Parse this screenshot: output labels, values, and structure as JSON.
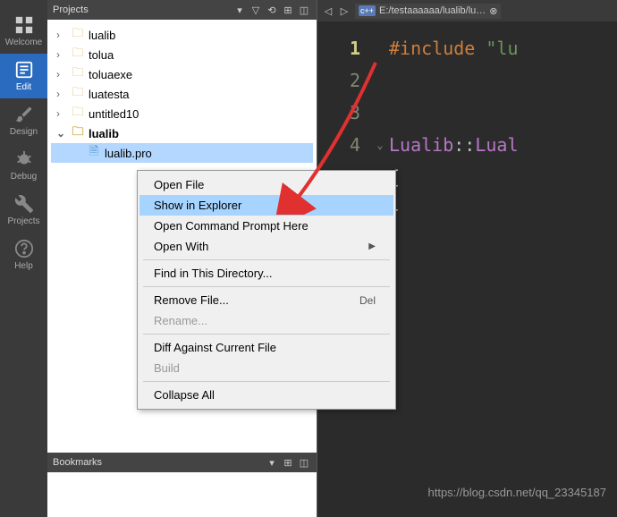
{
  "sidebar": {
    "items": [
      {
        "label": "Welcome",
        "active": false
      },
      {
        "label": "Edit",
        "active": true
      },
      {
        "label": "Design",
        "active": false
      },
      {
        "label": "Debug",
        "active": false
      },
      {
        "label": "Projects",
        "active": false
      },
      {
        "label": "Help",
        "active": false
      }
    ]
  },
  "projects_panel": {
    "title": "Projects",
    "tree": [
      {
        "label": "lualib",
        "level": 1,
        "expanded": false
      },
      {
        "label": "tolua",
        "level": 1,
        "expanded": false
      },
      {
        "label": "toluaexe",
        "level": 1,
        "expanded": false
      },
      {
        "label": "luatesta",
        "level": 1,
        "expanded": false
      },
      {
        "label": "untitled10",
        "level": 1,
        "expanded": false
      },
      {
        "label": "lualib",
        "level": 1,
        "expanded": true,
        "bold": true
      },
      {
        "label": "lualib.pro",
        "level": 2,
        "file": true,
        "selected": true
      }
    ]
  },
  "bookmarks_panel": {
    "title": "Bookmarks"
  },
  "editor": {
    "tab_path": "E:/testaaaaaa/lualib/lu…",
    "tab_badge": "c++",
    "lines": {
      "l1": {
        "num": "1"
      },
      "l2": {
        "num": "2"
      },
      "l3": {
        "num": "3"
      },
      "l4": {
        "num": "4"
      }
    },
    "code": {
      "include": "#include",
      "include_str": "\"lu",
      "type1": "Lualib",
      "scope": "::",
      "type2": "Lual",
      "brace_open": "{",
      "brace_close": "}"
    }
  },
  "context_menu": {
    "items": {
      "open_file": "Open File",
      "show_explorer": "Show in Explorer",
      "open_cmd": "Open Command Prompt Here",
      "open_with": "Open With",
      "find_dir": "Find in This Directory...",
      "remove_file": "Remove File...",
      "remove_shortcut": "Del",
      "rename": "Rename...",
      "diff": "Diff Against Current File",
      "build": "Build",
      "collapse": "Collapse All"
    }
  },
  "watermark": "https://blog.csdn.net/qq_23345187"
}
